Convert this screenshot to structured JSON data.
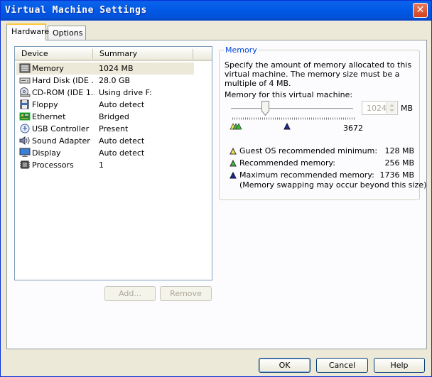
{
  "window": {
    "title": "Virtual Machine Settings",
    "close_glyph": "✕"
  },
  "tabs": [
    {
      "label": "Hardware",
      "active": true
    },
    {
      "label": "Options",
      "active": false
    }
  ],
  "device_list": {
    "columns": [
      "Device",
      "Summary"
    ],
    "rows": [
      {
        "icon": "memory-icon",
        "device": "Memory",
        "summary": "1024 MB",
        "selected": true
      },
      {
        "icon": "hard-disk-icon",
        "device": "Hard Disk (IDE ...",
        "summary": "28.0 GB"
      },
      {
        "icon": "cdrom-icon",
        "device": "CD-ROM (IDE 1...",
        "summary": "Using drive F:"
      },
      {
        "icon": "floppy-icon",
        "device": "Floppy",
        "summary": "Auto detect"
      },
      {
        "icon": "ethernet-icon",
        "device": "Ethernet",
        "summary": "Bridged"
      },
      {
        "icon": "usb-icon",
        "device": "USB Controller",
        "summary": "Present"
      },
      {
        "icon": "sound-icon",
        "device": "Sound Adapter",
        "summary": "Auto detect"
      },
      {
        "icon": "display-icon",
        "device": "Display",
        "summary": "Auto detect"
      },
      {
        "icon": "processor-icon",
        "device": "Processors",
        "summary": "1"
      }
    ]
  },
  "list_buttons": {
    "add": "Add...",
    "remove": "Remove"
  },
  "memory": {
    "group_title": "Memory",
    "description": "Specify the amount of memory allocated to this virtual machine. The memory size must be a multiple of 4 MB.",
    "field_label": "Memory for this virtual machine:",
    "value": "1024",
    "unit": "MB",
    "slider_max": "3672",
    "legend": [
      {
        "color": "#f5e44a",
        "label": "Guest OS recommended minimum:",
        "value": "128 MB"
      },
      {
        "color": "#3cb83c",
        "label": "Recommended memory:",
        "value": "256 MB"
      },
      {
        "color": "#1a2a9c",
        "label": "Maximum recommended memory:",
        "value": "1736 MB"
      }
    ],
    "note": "(Memory swapping may occur beyond this size)"
  },
  "footer": {
    "ok": "OK",
    "cancel": "Cancel",
    "help": "Help"
  }
}
